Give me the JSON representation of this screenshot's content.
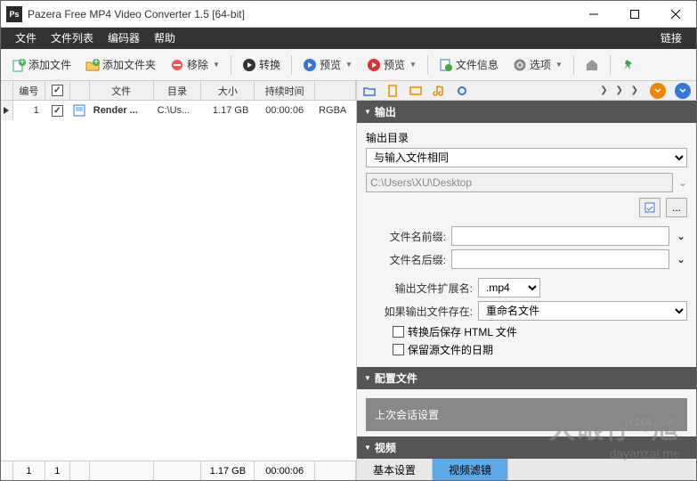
{
  "title": "Pazera Free MP4 Video Converter 1.5  [64-bit]",
  "app_icon_text": "Ps",
  "menubar": {
    "file": "文件",
    "filelist": "文件列表",
    "encoder": "编码器",
    "help": "帮助",
    "link": "链接"
  },
  "toolbar": {
    "add_file": "添加文件",
    "add_folder": "添加文件夹",
    "remove": "移除",
    "convert": "转换",
    "preview1": "预览",
    "preview2": "预览",
    "file_info": "文件信息",
    "options": "选项"
  },
  "grid": {
    "headers": {
      "num": "编号",
      "file": "文件",
      "dir": "目录",
      "size": "大小",
      "dur": "持续时间"
    },
    "row": {
      "num": "1",
      "file": "Render ...",
      "dir": "C:\\Us...",
      "size": "1.17 GB",
      "dur": "00:00:06",
      "ext": "RGBA"
    },
    "footer": {
      "count1": "1",
      "count2": "1",
      "size": "1.17 GB",
      "dur": "00:00:06"
    }
  },
  "right": {
    "tabs_more": "❯ ❯ ❯",
    "output": {
      "title": "输出",
      "outdir_label": "输出目录",
      "outdir_same": "与输入文件相同",
      "outdir_path": "C:\\Users\\XU\\Desktop",
      "prefix_label": "文件名前缀:",
      "suffix_label": "文件名后缀:",
      "ext_label": "输出文件扩展名:",
      "ext_value": ".mp4",
      "exists_label": "如果输出文件存在:",
      "exists_value": "重命名文件",
      "chk_html": "转换后保存 HTML 文件",
      "chk_date": "保留源文件的日期"
    },
    "config": {
      "title": "配置文件",
      "last": "上次会话设置"
    },
    "video": {
      "title": "视频",
      "basic": "基本设置",
      "filter": "视频滤镜"
    }
  },
  "codec": "H.264 / AVC",
  "watermark": {
    "big": "大眼仔~旭",
    "small": "dayanzai.me"
  }
}
